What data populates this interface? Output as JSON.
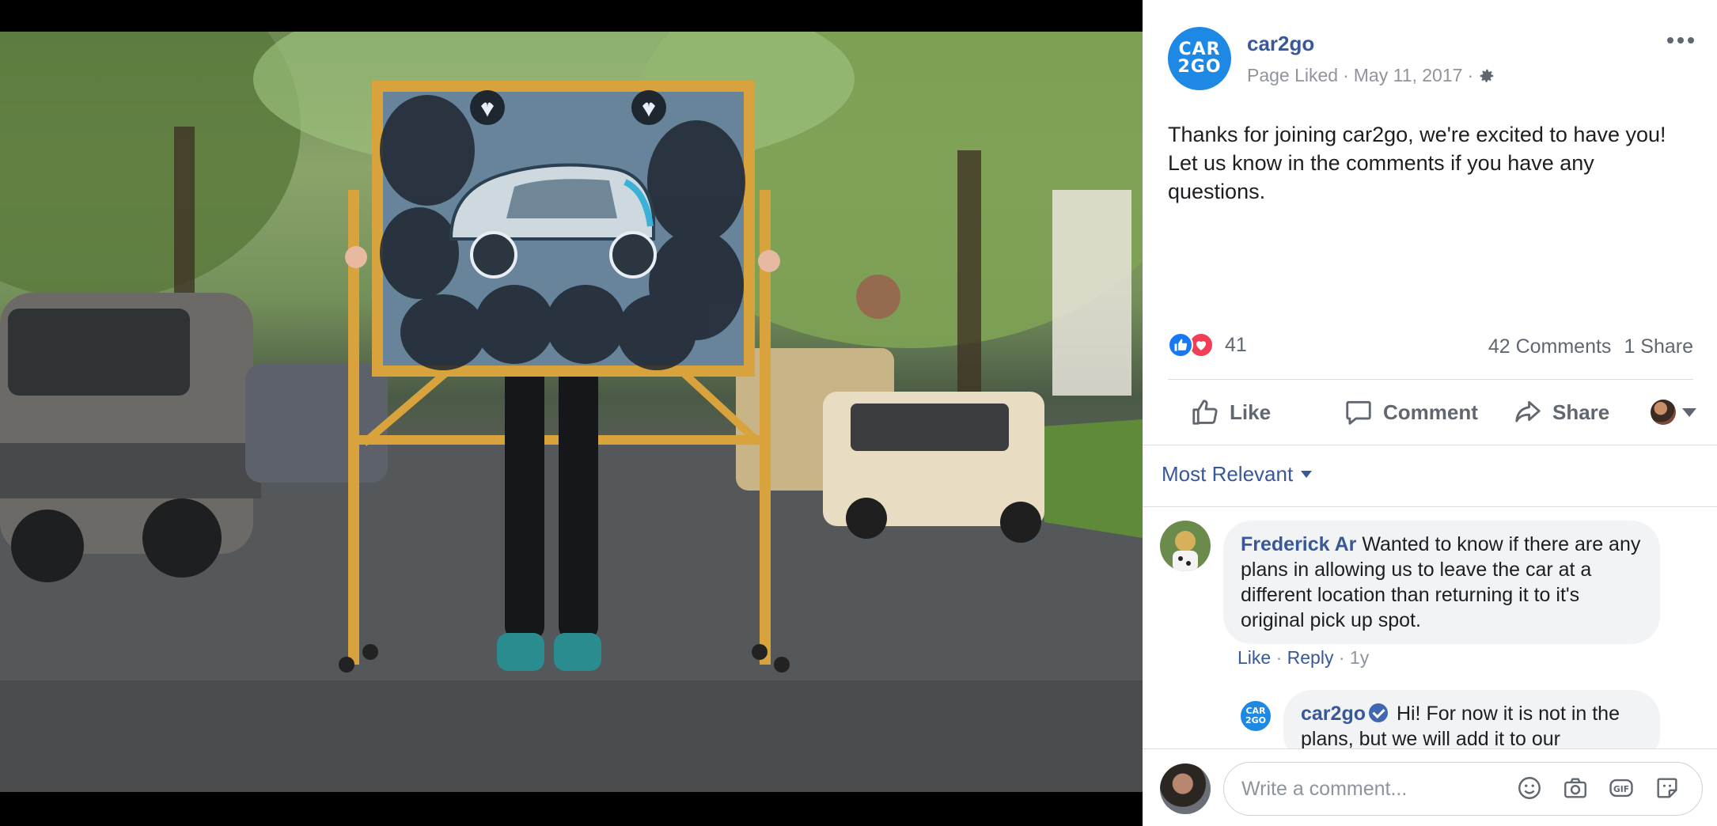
{
  "post": {
    "page_name": "car2go",
    "avatar_text_top": "CAR",
    "avatar_text_bottom": "2GO",
    "meta_status": "Page Liked",
    "meta_sep": "·",
    "meta_date": "May 11, 2017",
    "text": "Thanks for joining car2go, we're excited to have you! Let us know in the comments if you have any questions.",
    "reaction_count": "41",
    "comments_count": "42 Comments",
    "shares_count": "1 Share"
  },
  "actions": {
    "like": "Like",
    "comment": "Comment",
    "share": "Share"
  },
  "sort_label": "Most Relevant",
  "comments": [
    {
      "author": "Frederick Ar",
      "text": "Wanted to know if there are any plans in allowing us to leave the car at a different location than returning it to it's original pick up spot.",
      "like": "Like",
      "sep": "·",
      "reply": "Reply",
      "age": "1y"
    },
    {
      "author": "car2go",
      "avatar_text_top": "CAR",
      "avatar_text_bottom": "2GO",
      "text": "Hi! For now it is not in the plans, but we will add it to our"
    }
  ],
  "composer": {
    "placeholder": "Write a comment..."
  },
  "colors": {
    "link": "#385898",
    "brand_blue": "#1e88e5",
    "like_blue": "#1877f2",
    "love_red": "#f33e58",
    "muted": "#90949c"
  },
  "icons": [
    "gear-icon",
    "more-icon",
    "like-reaction-icon",
    "love-reaction-icon",
    "thumbs-up-icon",
    "comment-bubble-icon",
    "share-arrow-icon",
    "emoji-icon",
    "camera-icon",
    "gif-icon",
    "sticker-icon"
  ]
}
